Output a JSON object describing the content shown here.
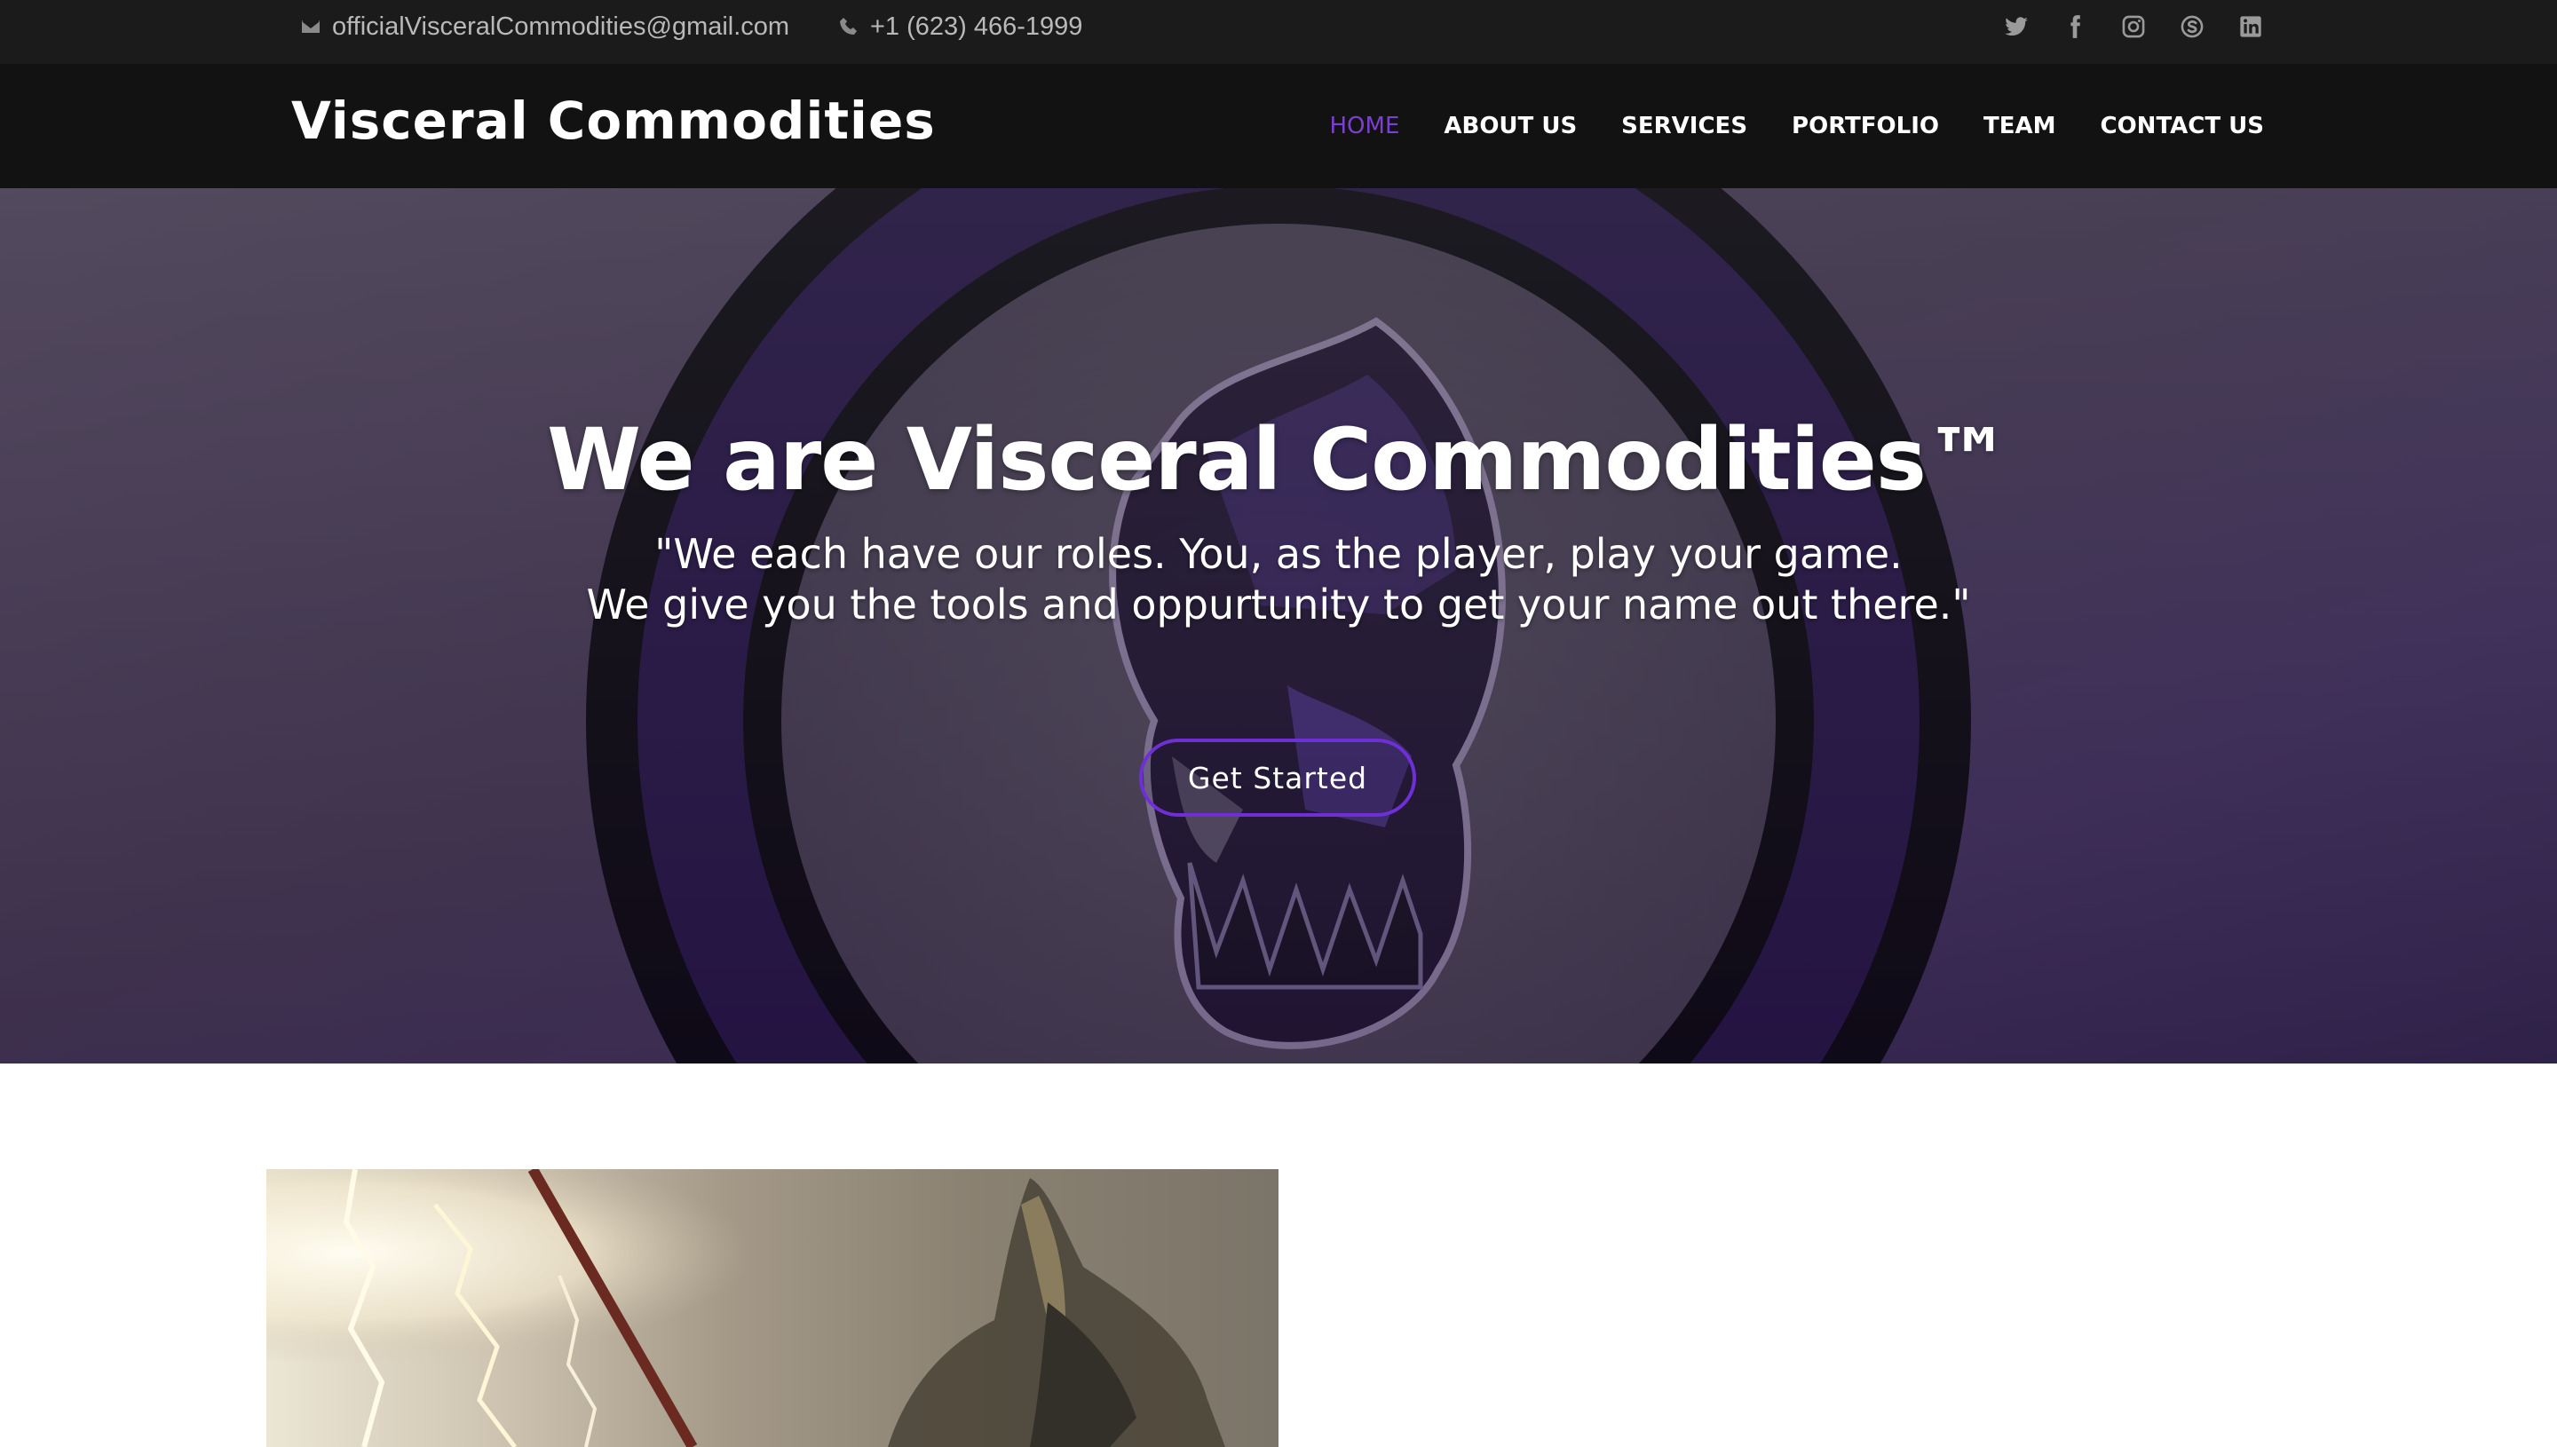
{
  "topbar": {
    "email": "officialVisceralCommodities@gmail.com",
    "phone": "+1 (623) 466-1999",
    "socials": [
      "twitter-icon",
      "facebook-icon",
      "instagram-icon",
      "skype-icon",
      "linkedin-icon"
    ]
  },
  "header": {
    "logo": "Visceral Commodities",
    "nav": [
      {
        "label": "HOME"
      },
      {
        "label": "ABOUT US"
      },
      {
        "label": "SERVICES"
      },
      {
        "label": "PORTFOLIO"
      },
      {
        "label": "TEAM"
      },
      {
        "label": "CONTACT US"
      }
    ]
  },
  "hero": {
    "title": "We are Visceral Commodities™",
    "quote_line1": "\"We each have our roles. You, as the player, play your game.",
    "quote_line2": "We give you the tools and oppurtunity to get your name out there.\"",
    "cta": "Get Started"
  },
  "colors": {
    "accent": "#7b3fd4",
    "topbar_bg": "#1b1b1b",
    "header_bg": "#121212",
    "button_border": "#6f2fd6"
  }
}
